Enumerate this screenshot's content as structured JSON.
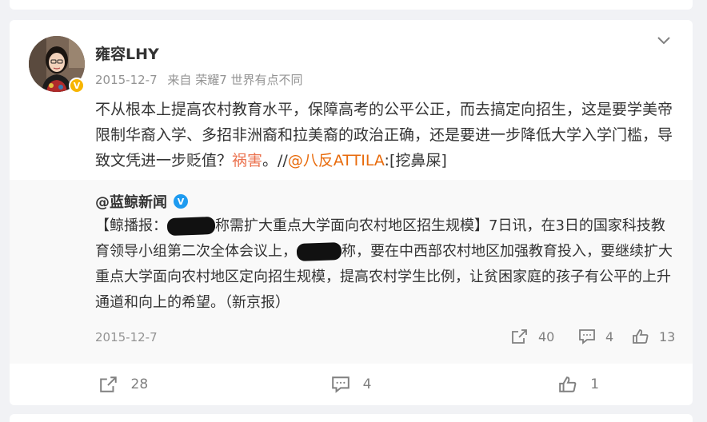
{
  "post": {
    "username": "雍容LHY",
    "date": "2015-12-7",
    "source": "来自 荣耀7 世界有点不同",
    "text_main": "不从根本上提高农村教育水平，保障高考的公平公正，而去搞定向招生，这是要学美帝限制华裔入学、多招非洲裔和拉美裔的政治正确，还是要进一步降低大学入学门槛，导致文凭进一步贬值？",
    "emoji_text": "祸害",
    "period": "。//",
    "mention": "@八反ATTILA",
    "mention_suffix": ":[挖鼻屎]"
  },
  "repost": {
    "author": "@蓝鲸新闻",
    "text_part1": "【鲸播报：",
    "text_part2": "称需扩大重点大学面向农村地区招生规模】7日讯，在3日的国家科技教育领导小组第二次全体会议上，",
    "text_part3": "称，要在中西部农村地区加强教育投入，要继续扩大重点大学面向农村地区定向招生规模，提高农村学生比例，让贫困家庭的孩子有公平的上升通道和向上的希望。（新京报）",
    "date": "2015-12-7",
    "share_count": "40",
    "comment_count": "4",
    "like_count": "13"
  },
  "actions": {
    "share_count": "28",
    "comment_count": "4",
    "like_count": "1"
  },
  "icons": {
    "chevron": "chevron-down-icon",
    "share": "share-icon",
    "comment": "comment-icon",
    "like": "thumbs-up-icon",
    "verified_user": "verified-gold-badge",
    "verified_org": "verified-blue-badge"
  },
  "colors": {
    "mention": "#e86b0c",
    "emoji_text": "#eb7350",
    "verified_gold": "#f7b500",
    "verified_blue": "#1e9bf0"
  }
}
